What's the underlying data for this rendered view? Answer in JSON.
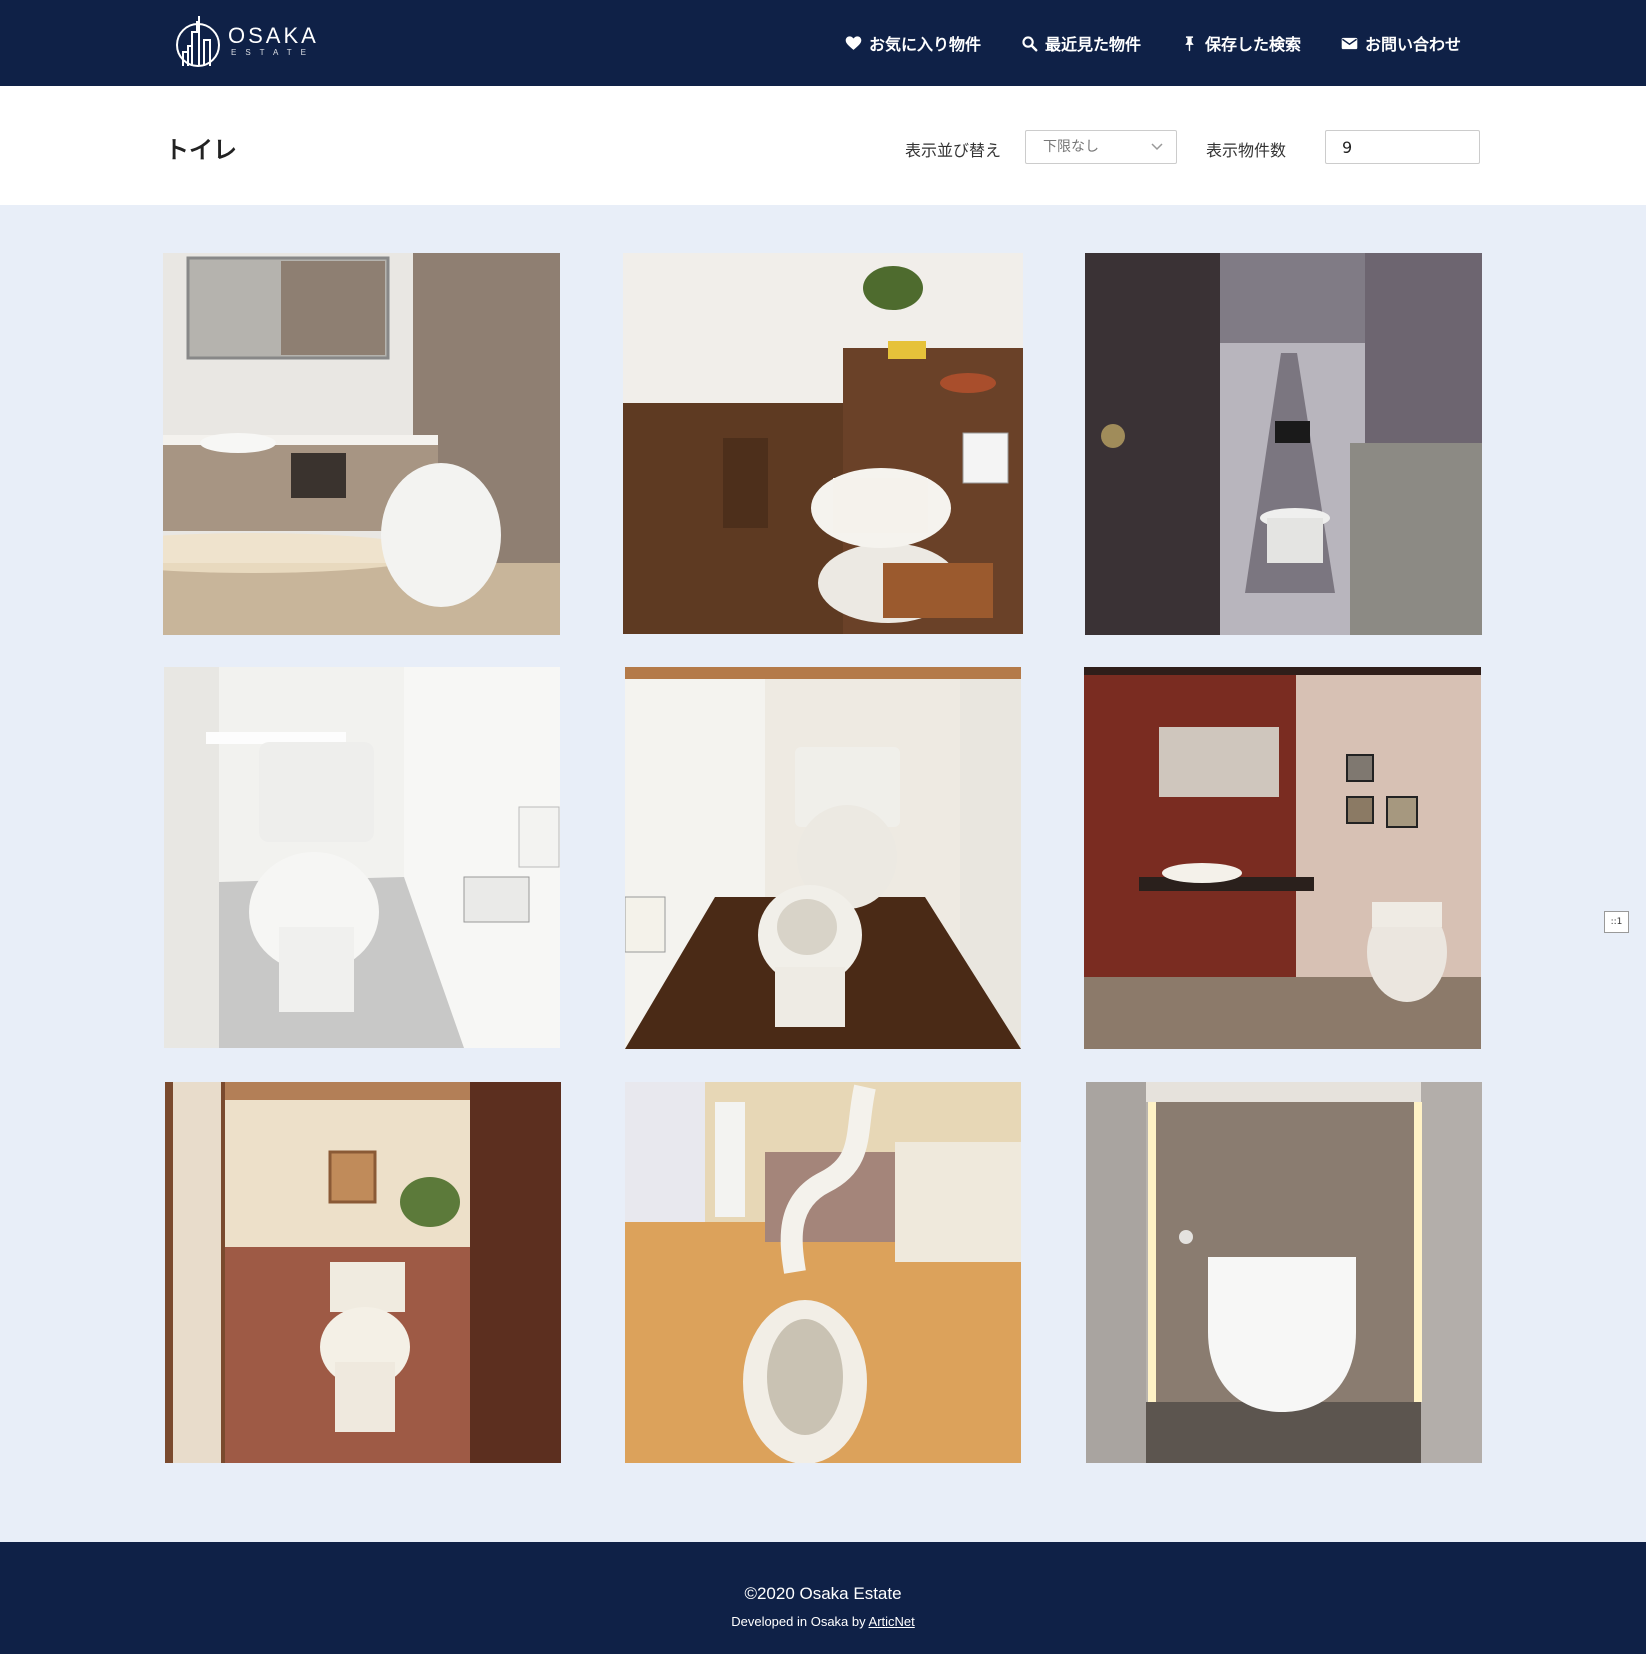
{
  "header": {
    "logo_main": "OSAKA",
    "logo_sub": "ESTATE",
    "nav": [
      {
        "label": "お気に入り物件",
        "icon": "heart-icon"
      },
      {
        "label": "最近見た物件",
        "icon": "search-icon"
      },
      {
        "label": "保存した検索",
        "icon": "pin-icon"
      },
      {
        "label": "お問い合わせ",
        "icon": "envelope-icon"
      }
    ]
  },
  "toolbar": {
    "title": "トイレ",
    "sort_label": "表示並び替え",
    "sort_value": "下限なし",
    "count_label": "表示物件数",
    "count_value": "9"
  },
  "colors": {
    "navy": "#0f2147",
    "page_bg": "#e8eef8"
  },
  "side_handle": "::1",
  "footer": {
    "copyright": "©2020 Osaka Estate",
    "developed_prefix": "Developed in Osaka by ",
    "developer_link": "ArticNet"
  }
}
